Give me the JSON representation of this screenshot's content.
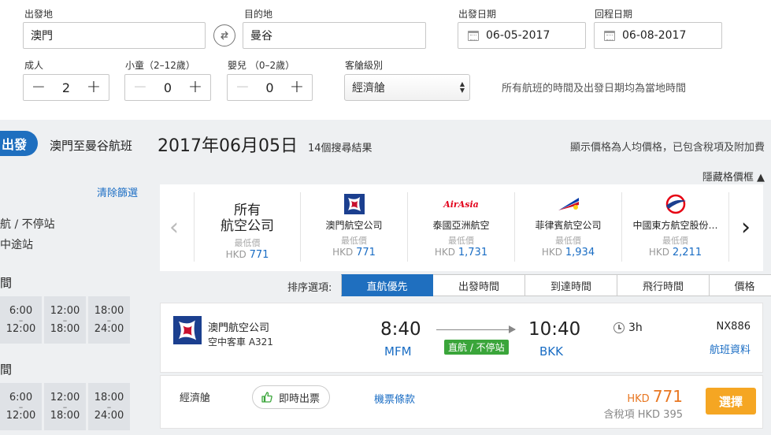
{
  "search": {
    "origin_label": "出發地",
    "origin_value": "澳門",
    "destination_label": "目的地",
    "destination_value": "曼谷",
    "depart_label": "出發日期",
    "depart_value": "06-05-2017",
    "return_label": "回程日期",
    "return_value": "06-08-2017",
    "adults_label": "成人",
    "adults_value": "2",
    "children_label": "小童（2–12歲）",
    "children_value": "0",
    "infants_label": "嬰兒 （0–2歲）",
    "infants_value": "0",
    "cabin_label": "客艙級別",
    "cabin_value": "經濟艙",
    "local_time_note": "所有航班的時間及出發日期均為當地時間"
  },
  "header": {
    "depart_tag": "出發",
    "route": "澳門至曼谷航班",
    "date": "2017年06月05日",
    "result_count": "14個搜尋結果",
    "price_note": "顯示價格為人均價格，已包含稅項及附加費",
    "hide_price": "隱藏格價框 ▲"
  },
  "sidebar": {
    "clear_filters": "清除篩選",
    "stop_direct": "航 / 不停站",
    "stop_via": "中途站",
    "section1": "間",
    "section2": "間",
    "time_slots": [
      {
        "from": "6:00",
        "to": "12:00"
      },
      {
        "from": "12:00",
        "to": "18:00"
      },
      {
        "from": "18:00",
        "to": "24:00"
      }
    ]
  },
  "carousel": {
    "all_line1": "所有",
    "all_line2": "航空公司",
    "lowest_label": "最低價",
    "currency": "HKD",
    "all_price": "771",
    "airlines": [
      {
        "name": "澳門航空公司",
        "price": "771",
        "color": "#c8102e"
      },
      {
        "name": "泰國亞洲航空",
        "price": "1,731",
        "color": "#e2001a",
        "logo_text": "AirAsia"
      },
      {
        "name": "菲律賓航空公司",
        "price": "1,934",
        "color": "#0038a8"
      },
      {
        "name": "中國東方航空股份…",
        "price": "2,211",
        "color": "#e60012"
      }
    ]
  },
  "sort": {
    "label": "排序選項:",
    "options": [
      "直航優先",
      "出發時間",
      "到達時間",
      "飛行時間",
      "價格"
    ]
  },
  "flight": {
    "airline": "澳門航空公司",
    "aircraft": "空中客車 A321",
    "dep_time": "8:40",
    "dep_airport": "MFM",
    "arr_time": "10:40",
    "arr_airport": "BKK",
    "direct_badge": "直航 / 不停站",
    "duration": "3h",
    "flight_no": "NX886",
    "flight_info": "航班資料"
  },
  "fare": {
    "cabin": "經濟艙",
    "instant_ticket": "即時出票",
    "terms": "機票條款",
    "currency": "HKD",
    "price": "771",
    "tax_label": "含稅項 HKD 395",
    "select_button": "選擇"
  }
}
